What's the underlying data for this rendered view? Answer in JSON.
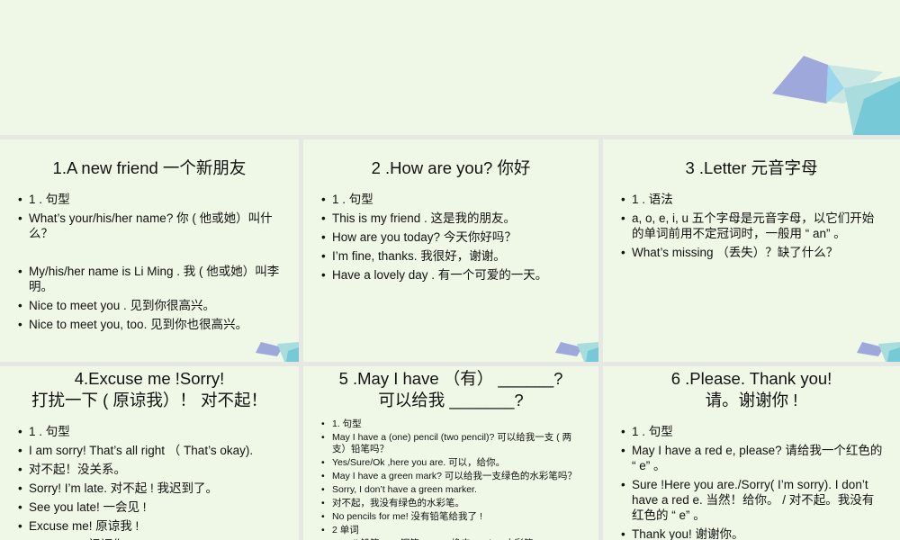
{
  "colors": {
    "background": "#eff8e6",
    "gap": "#e6e8e3",
    "accent_purple": "#9ea8db",
    "accent_teal": "#76c9d6"
  },
  "panels": [
    {
      "title": [
        "1.A new friend 一个新朋友"
      ],
      "items": [
        "1 . 句型",
        "What’s your/his/her name?            你 ( 他或她）叫什么？",
        "",
        "My/his/her name is Li Ming .  我 ( 他或她）叫李明。",
        "Nice to meet you . 见到你很高兴。",
        "Nice to meet you, too. 见到你也很高兴。"
      ]
    },
    {
      "title": [
        "2 .How are you? 你好"
      ],
      "items": [
        "1 . 句型",
        "This is my friend . 这是我的朋友。",
        "How are you today?     今天你好吗？",
        "I’m fine, thanks. 我很好，谢谢。",
        "Have a lovely day . 有一个可爱的一天。"
      ]
    },
    {
      "title": [
        "3 .Letter  元音字母"
      ],
      "items": [
        "1 . 语法",
        "a, o, e, i, u 五个字母是元音字母，以它们开始的单词前用不定冠词时，一般用 “ an” 。",
        "What’s missing （丢失）？缺了什么？"
      ]
    },
    {
      "title": [
        "4.Excuse me !Sorry!",
        "打扰一下 ( 原谅我）！ 对不起！"
      ],
      "items": [
        "1 . 句型",
        "I am sorry! That’s all right （ That’s okay).",
        "对不起！没关系。",
        "Sorry! I’m late. 对不起 ! 我迟到了。",
        "See you late!  一会见 !",
        "Excuse me!  原谅我 !",
        "Bless you!  祝福你 !"
      ]
    },
    {
      "title": [
        "5 .May I have （有）  ______?",
        "可以给我 _______?"
      ],
      "items": [
        "1. 句型",
        "May I have a (one) pencil (two pencil)? 可以给我一支 ( 两支）铅笔吗？",
        "Yes/Sure/Ok ,here you are. 可以，给你。",
        "May I have a green mark? 可以给我一支绿色的水彩笔吗？",
        "Sorry, I don’t have a green marker.",
        "对不起，我没有绿色的水彩笔。",
        "No pencils for me! 没有铅笔给我了 !",
        "2 单词",
        "Pencil 铅笔    pen 钢笔    eraser 橡皮    marker 水彩笔"
      ]
    },
    {
      "title": [
        "6 .Please. Thank you!",
        "请。谢谢你 !"
      ],
      "items": [
        "1 . 句型",
        "May I have a red e, please? 请给我一个红色的 “ e” 。",
        "Sure !Here you are./Sorry( I’m sorry). I don’t have a red e. 当然！给你。 / 对不起。我没有红色的 “ e” 。",
        "Thank you! 谢谢你。"
      ]
    }
  ]
}
